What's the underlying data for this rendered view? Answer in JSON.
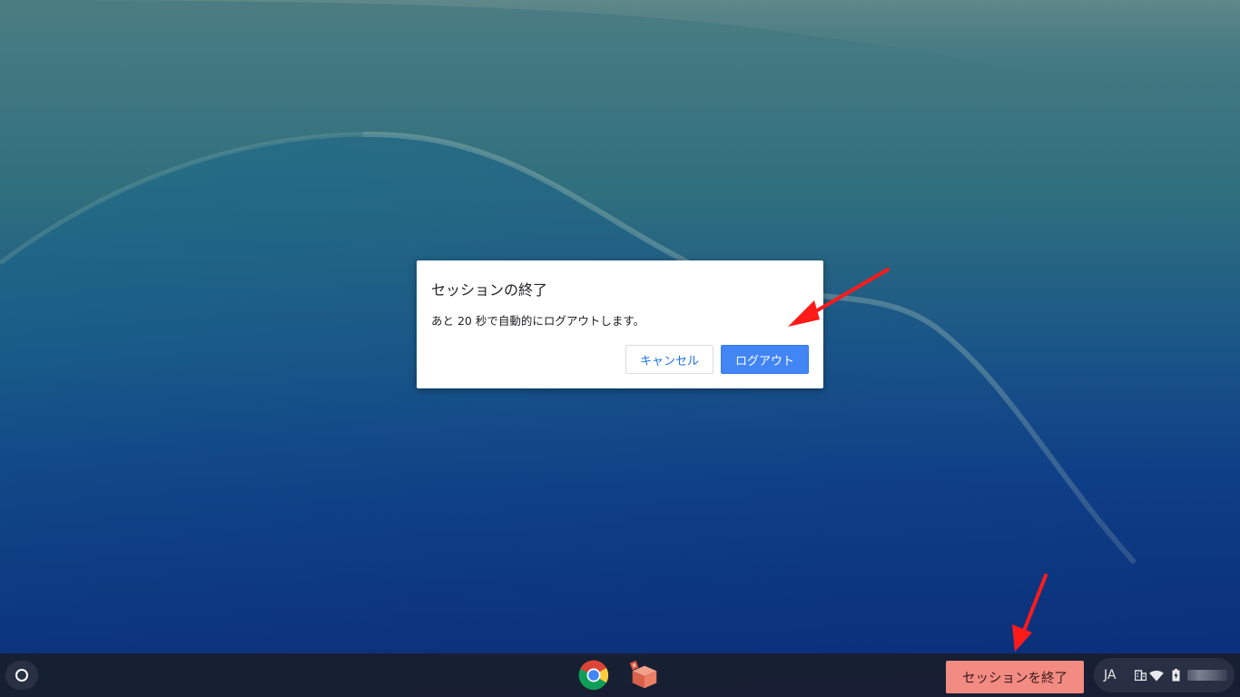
{
  "dialog": {
    "title": "セッションの終了",
    "message": "あと 20 秒で自動的にログアウトします。",
    "cancel_label": "キャンセル",
    "logout_label": "ログアウト"
  },
  "shelf": {
    "launcher_icon": "launcher-circle-icon",
    "apps": [
      {
        "name": "Google Chrome",
        "icon": "chrome-icon"
      },
      {
        "name": "Package app",
        "icon": "package-icon"
      }
    ],
    "end_session_label": "セッションを終了",
    "status": {
      "ime": "JA",
      "icons": [
        "managed-org-icon",
        "wifi-icon",
        "battery-icon"
      ],
      "clock": ""
    }
  },
  "colors": {
    "dialog_primary": "#4285f4",
    "end_session_bg": "#f28b82",
    "annotation_arrow": "#ff0000",
    "shelf_bg": "#181e30"
  }
}
